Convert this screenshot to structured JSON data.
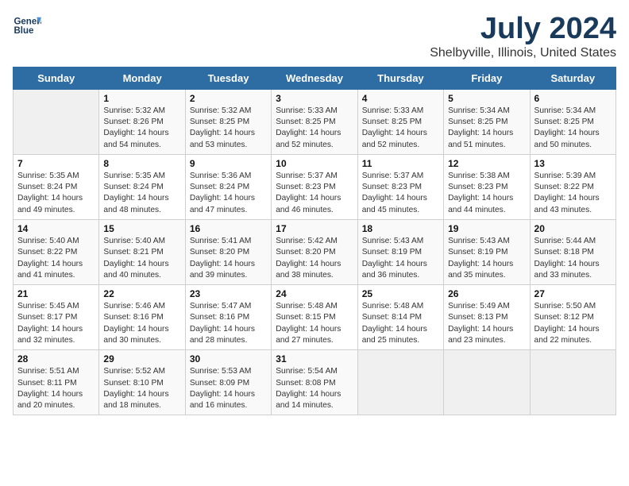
{
  "header": {
    "logo_line1": "General",
    "logo_line2": "Blue",
    "month_year": "July 2024",
    "location": "Shelbyville, Illinois, United States"
  },
  "days_of_week": [
    "Sunday",
    "Monday",
    "Tuesday",
    "Wednesday",
    "Thursday",
    "Friday",
    "Saturday"
  ],
  "weeks": [
    [
      {
        "day": "",
        "info": ""
      },
      {
        "day": "1",
        "info": "Sunrise: 5:32 AM\nSunset: 8:26 PM\nDaylight: 14 hours\nand 54 minutes."
      },
      {
        "day": "2",
        "info": "Sunrise: 5:32 AM\nSunset: 8:25 PM\nDaylight: 14 hours\nand 53 minutes."
      },
      {
        "day": "3",
        "info": "Sunrise: 5:33 AM\nSunset: 8:25 PM\nDaylight: 14 hours\nand 52 minutes."
      },
      {
        "day": "4",
        "info": "Sunrise: 5:33 AM\nSunset: 8:25 PM\nDaylight: 14 hours\nand 52 minutes."
      },
      {
        "day": "5",
        "info": "Sunrise: 5:34 AM\nSunset: 8:25 PM\nDaylight: 14 hours\nand 51 minutes."
      },
      {
        "day": "6",
        "info": "Sunrise: 5:34 AM\nSunset: 8:25 PM\nDaylight: 14 hours\nand 50 minutes."
      }
    ],
    [
      {
        "day": "7",
        "info": "Sunrise: 5:35 AM\nSunset: 8:24 PM\nDaylight: 14 hours\nand 49 minutes."
      },
      {
        "day": "8",
        "info": "Sunrise: 5:35 AM\nSunset: 8:24 PM\nDaylight: 14 hours\nand 48 minutes."
      },
      {
        "day": "9",
        "info": "Sunrise: 5:36 AM\nSunset: 8:24 PM\nDaylight: 14 hours\nand 47 minutes."
      },
      {
        "day": "10",
        "info": "Sunrise: 5:37 AM\nSunset: 8:23 PM\nDaylight: 14 hours\nand 46 minutes."
      },
      {
        "day": "11",
        "info": "Sunrise: 5:37 AM\nSunset: 8:23 PM\nDaylight: 14 hours\nand 45 minutes."
      },
      {
        "day": "12",
        "info": "Sunrise: 5:38 AM\nSunset: 8:23 PM\nDaylight: 14 hours\nand 44 minutes."
      },
      {
        "day": "13",
        "info": "Sunrise: 5:39 AM\nSunset: 8:22 PM\nDaylight: 14 hours\nand 43 minutes."
      }
    ],
    [
      {
        "day": "14",
        "info": "Sunrise: 5:40 AM\nSunset: 8:22 PM\nDaylight: 14 hours\nand 41 minutes."
      },
      {
        "day": "15",
        "info": "Sunrise: 5:40 AM\nSunset: 8:21 PM\nDaylight: 14 hours\nand 40 minutes."
      },
      {
        "day": "16",
        "info": "Sunrise: 5:41 AM\nSunset: 8:20 PM\nDaylight: 14 hours\nand 39 minutes."
      },
      {
        "day": "17",
        "info": "Sunrise: 5:42 AM\nSunset: 8:20 PM\nDaylight: 14 hours\nand 38 minutes."
      },
      {
        "day": "18",
        "info": "Sunrise: 5:43 AM\nSunset: 8:19 PM\nDaylight: 14 hours\nand 36 minutes."
      },
      {
        "day": "19",
        "info": "Sunrise: 5:43 AM\nSunset: 8:19 PM\nDaylight: 14 hours\nand 35 minutes."
      },
      {
        "day": "20",
        "info": "Sunrise: 5:44 AM\nSunset: 8:18 PM\nDaylight: 14 hours\nand 33 minutes."
      }
    ],
    [
      {
        "day": "21",
        "info": "Sunrise: 5:45 AM\nSunset: 8:17 PM\nDaylight: 14 hours\nand 32 minutes."
      },
      {
        "day": "22",
        "info": "Sunrise: 5:46 AM\nSunset: 8:16 PM\nDaylight: 14 hours\nand 30 minutes."
      },
      {
        "day": "23",
        "info": "Sunrise: 5:47 AM\nSunset: 8:16 PM\nDaylight: 14 hours\nand 28 minutes."
      },
      {
        "day": "24",
        "info": "Sunrise: 5:48 AM\nSunset: 8:15 PM\nDaylight: 14 hours\nand 27 minutes."
      },
      {
        "day": "25",
        "info": "Sunrise: 5:48 AM\nSunset: 8:14 PM\nDaylight: 14 hours\nand 25 minutes."
      },
      {
        "day": "26",
        "info": "Sunrise: 5:49 AM\nSunset: 8:13 PM\nDaylight: 14 hours\nand 23 minutes."
      },
      {
        "day": "27",
        "info": "Sunrise: 5:50 AM\nSunset: 8:12 PM\nDaylight: 14 hours\nand 22 minutes."
      }
    ],
    [
      {
        "day": "28",
        "info": "Sunrise: 5:51 AM\nSunset: 8:11 PM\nDaylight: 14 hours\nand 20 minutes."
      },
      {
        "day": "29",
        "info": "Sunrise: 5:52 AM\nSunset: 8:10 PM\nDaylight: 14 hours\nand 18 minutes."
      },
      {
        "day": "30",
        "info": "Sunrise: 5:53 AM\nSunset: 8:09 PM\nDaylight: 14 hours\nand 16 minutes."
      },
      {
        "day": "31",
        "info": "Sunrise: 5:54 AM\nSunset: 8:08 PM\nDaylight: 14 hours\nand 14 minutes."
      },
      {
        "day": "",
        "info": ""
      },
      {
        "day": "",
        "info": ""
      },
      {
        "day": "",
        "info": ""
      }
    ]
  ]
}
